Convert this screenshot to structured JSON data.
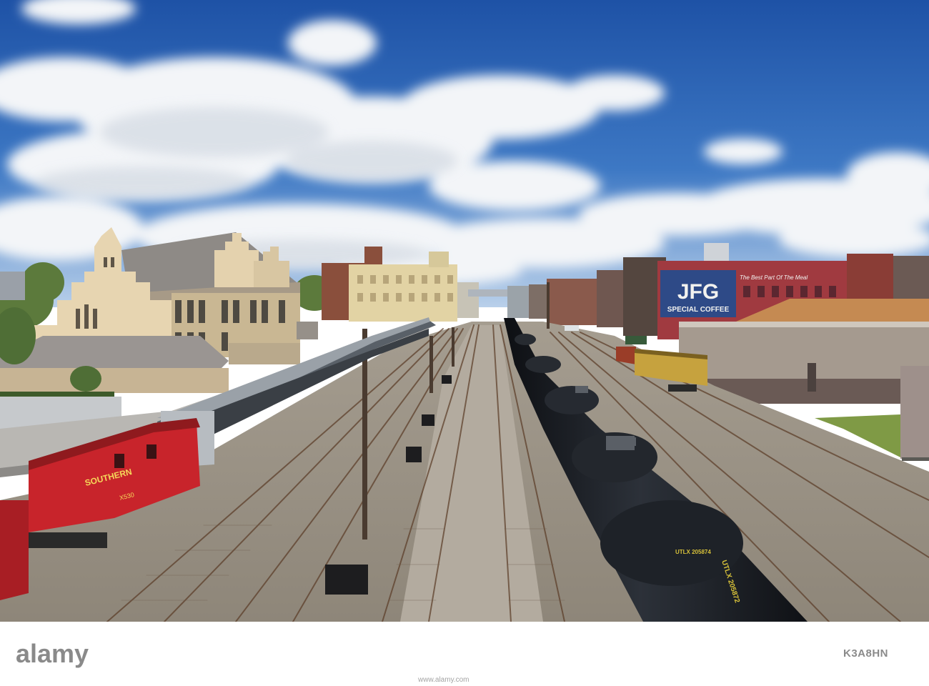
{
  "image": {
    "subject": "Freight rail yard beside a historic station"
  },
  "signs": {
    "billboard_logo": "JFG",
    "billboard_text": "SPECIAL COFFEE",
    "billboard_slogan": "The Best Part Of The Meal",
    "caboose_name": "SOUTHERN",
    "caboose_number": "X530",
    "tank_car_id": "UTLX 205874",
    "tank_car_id_rotated": "UTLX 205872"
  },
  "watermark": {
    "brand": "alamy",
    "image_id": "K3A8HN",
    "site": "www.alamy.com"
  },
  "colors": {
    "sky_top": "#1f54a8",
    "sky_bottom": "#9fbfe0",
    "station": "#e4d2ae",
    "caboose": "#c8242b",
    "tank_car": "#1c1f25",
    "billboard": "#2e4a87"
  }
}
